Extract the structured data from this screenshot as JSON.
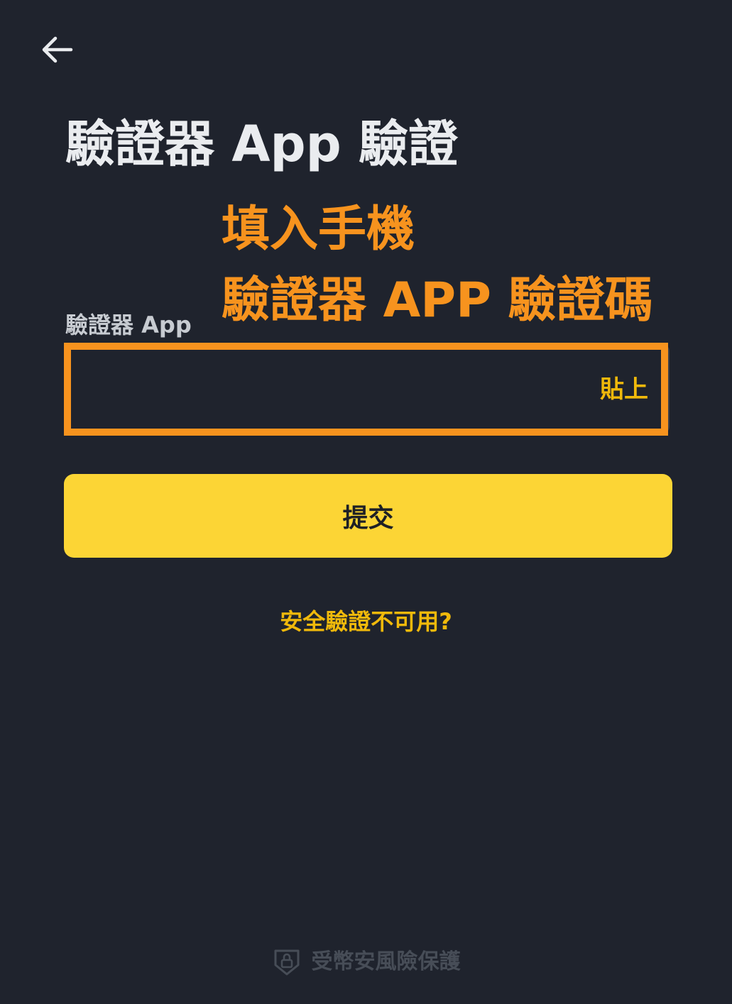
{
  "header": {
    "back_icon": "arrow-left-icon",
    "title": "驗證器 App 驗證"
  },
  "annotation": {
    "line1": "填入手機",
    "line2": "驗證器 APP 驗證碼",
    "color": "#f7931e"
  },
  "form": {
    "label": "驗證器 App",
    "input_value": "",
    "input_placeholder": "",
    "paste_label": "貼上",
    "submit_label": "提交"
  },
  "links": {
    "unavailable": "安全驗證不可用?"
  },
  "footer": {
    "icon": "shield-lock-icon",
    "text": "受幣安風險保護"
  },
  "colors": {
    "background": "#1f232d",
    "accent": "#fcd535",
    "link": "#f0b90b",
    "highlight": "#f7931e"
  }
}
